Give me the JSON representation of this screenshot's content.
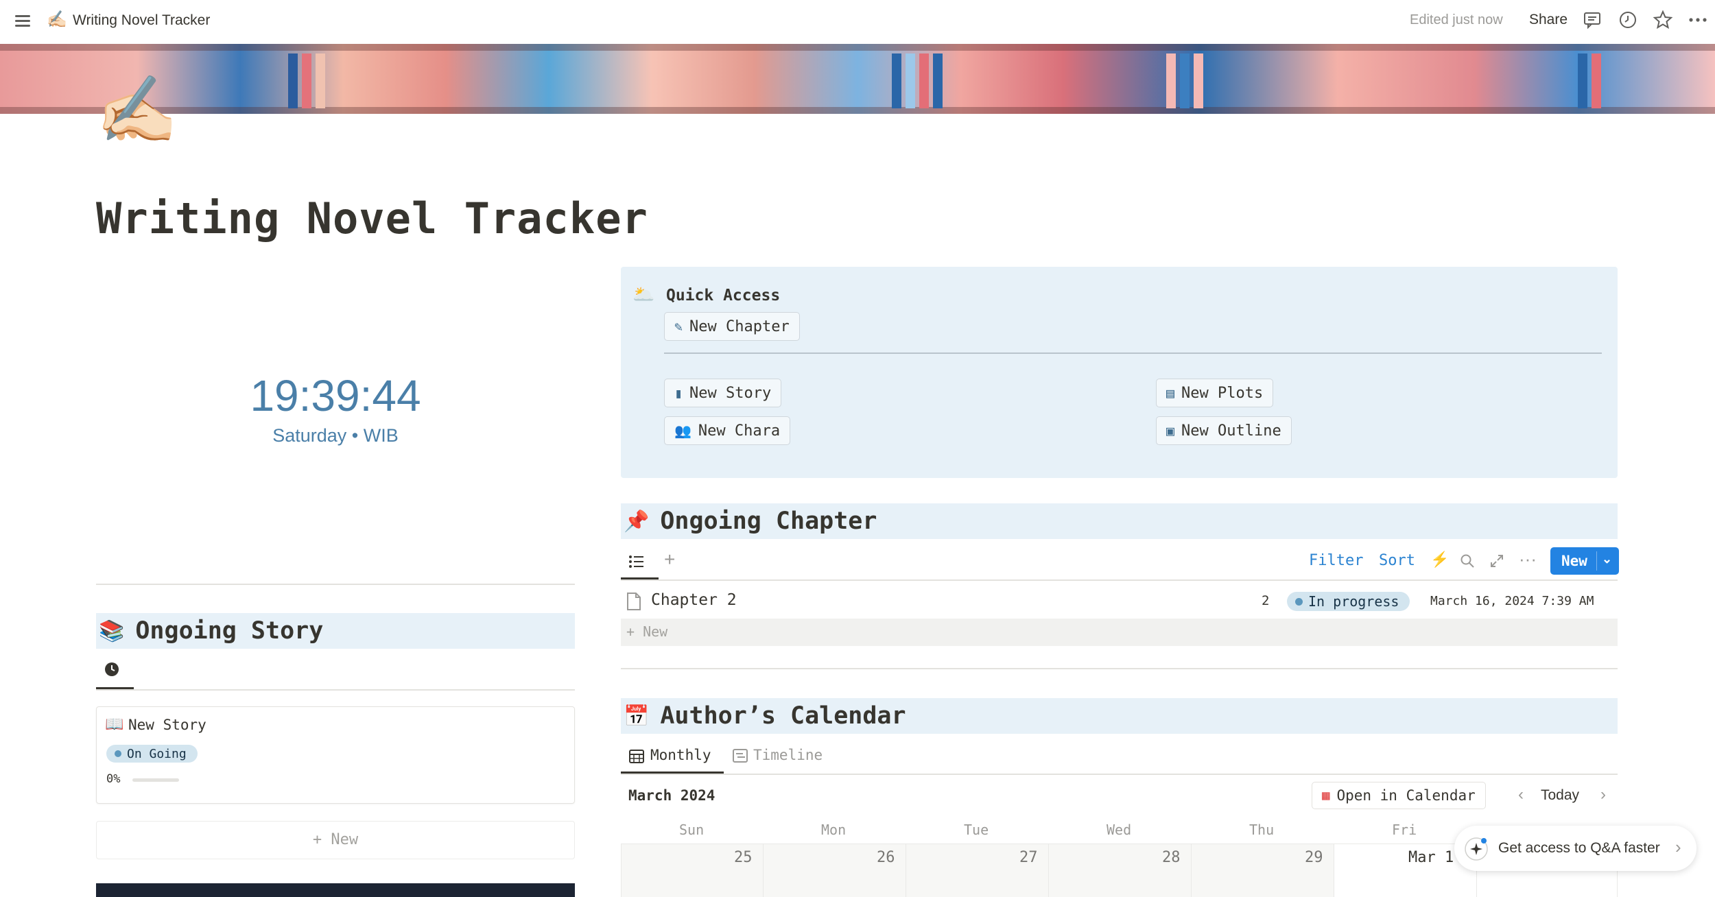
{
  "topbar": {
    "page_emoji": "✍🏻",
    "page_title": "Writing Novel Tracker",
    "edited": "Edited just now",
    "share": "Share"
  },
  "page": {
    "icon": "✍🏻",
    "title": "Writing Novel Tracker"
  },
  "clock": {
    "time": "19:39:44",
    "sub": "Saturday • WIB"
  },
  "quick_access": {
    "emoji": "🌥️",
    "title": "Quick Access",
    "buttons": {
      "new_chapter": "New Chapter",
      "new_story": "New Story",
      "new_chara": "New Chara",
      "new_plots": "New Plots",
      "new_outline": "New Outline"
    }
  },
  "ongoing_chapter": {
    "emoji": "📌",
    "title": "Ongoing Chapter",
    "toolbar": {
      "filter": "Filter",
      "sort": "Sort",
      "new": "New"
    },
    "rows": [
      {
        "name": "Chapter 2",
        "number": "2",
        "status": "In progress",
        "date": "March 16, 2024 7:39 AM"
      }
    ],
    "new_row": "+ New"
  },
  "ongoing_story": {
    "emoji": "📚",
    "title": "Ongoing Story",
    "card": {
      "emoji": "📖",
      "name": "New Story",
      "status": "On Going",
      "progress_label": "0%",
      "progress": 0
    },
    "new_label": "+ New"
  },
  "calendar": {
    "emoji": "📅",
    "title": "Author’s Calendar",
    "tabs": {
      "monthly": "Monthly",
      "timeline": "Timeline"
    },
    "month": "March 2024",
    "open_in_calendar": "Open in Calendar",
    "today": "Today",
    "days": [
      "Sun",
      "Mon",
      "Tue",
      "Wed",
      "Thu",
      "Fri"
    ],
    "dates": [
      "25",
      "26",
      "27",
      "28",
      "29",
      "Mar 1"
    ]
  },
  "toast": {
    "text": "Get access to Q&A faster"
  },
  "colors": {
    "accent": "#2383e2",
    "callout_bg": "#e7f1f8",
    "clock": "#4a7fa8"
  }
}
